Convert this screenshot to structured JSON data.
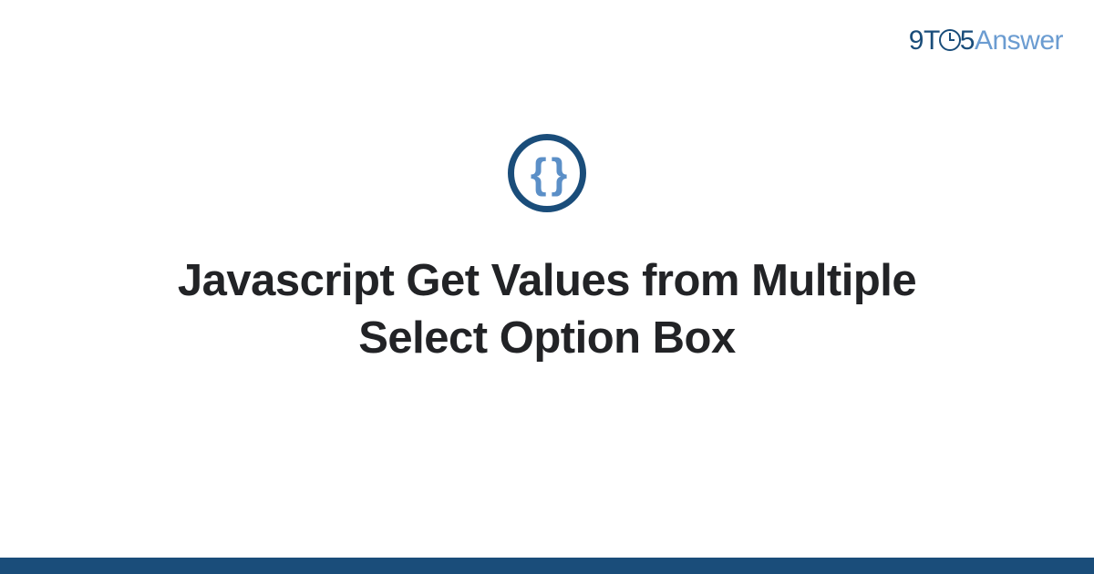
{
  "brand": {
    "nine": "9",
    "t": "T",
    "five": "5",
    "answer": "Answer"
  },
  "icon": {
    "braces": "{ }"
  },
  "title": "Javascript Get Values from Multiple Select Option Box"
}
